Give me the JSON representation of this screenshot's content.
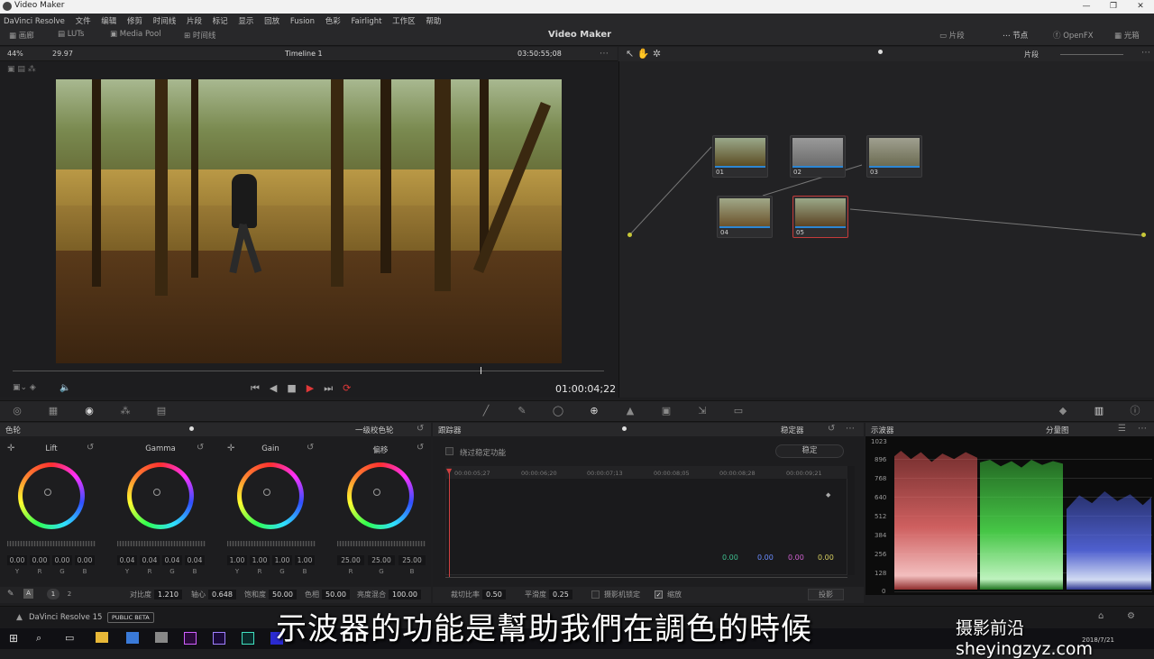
{
  "window": {
    "title": "Video Maker",
    "controls": [
      "—",
      "❐",
      "✕"
    ]
  },
  "menu": [
    "DaVinci Resolve",
    "文件",
    "编辑",
    "修剪",
    "时间线",
    "片段",
    "标记",
    "显示",
    "回放",
    "Fusion",
    "色彩",
    "Fairlight",
    "工作区",
    "帮助"
  ],
  "toolbar": {
    "gallery": "画廊",
    "luts": "LUTs",
    "media_pool": "Media Pool",
    "timeline": "时间线",
    "project_title": "Video Maker",
    "clips": "片段",
    "nodes": "节点",
    "openfx": "OpenFX",
    "lightbox": "光箱"
  },
  "viewer": {
    "zoom": "44%",
    "fps": "29.97",
    "timeline_name": "Timeline 1",
    "source_tc": "03:50:55;08",
    "record_tc": "01:00:04;22"
  },
  "node_editor": {
    "mode": "片段",
    "nodes": [
      {
        "id": "01",
        "label": "01"
      },
      {
        "id": "02",
        "label": "02"
      },
      {
        "id": "03",
        "label": "03"
      },
      {
        "id": "04",
        "label": "04"
      },
      {
        "id": "05",
        "label": "05"
      }
    ]
  },
  "color_wheels": {
    "title": "色轮",
    "mode": "一级校色轮",
    "wheels": [
      {
        "name": "Lift",
        "values": [
          "0.00",
          "0.00",
          "0.00",
          "0.00"
        ],
        "channels": [
          "Y",
          "R",
          "G",
          "B"
        ]
      },
      {
        "name": "Gamma",
        "values": [
          "0.04",
          "0.04",
          "0.04",
          "0.04"
        ],
        "channels": [
          "Y",
          "R",
          "G",
          "B"
        ]
      },
      {
        "name": "Gain",
        "values": [
          "1.00",
          "1.00",
          "1.00",
          "1.00"
        ],
        "channels": [
          "Y",
          "R",
          "G",
          "B"
        ]
      },
      {
        "name": "偏移",
        "values": [
          "25.00",
          "25.00",
          "25.00"
        ],
        "channels": [
          "R",
          "G",
          "B"
        ]
      }
    ],
    "footer": {
      "page1": "1",
      "page2": "2",
      "contrast_label": "对比度",
      "contrast": "1.210",
      "pivot_label": "轴心",
      "pivot": "0.648",
      "sat_label": "饱和度",
      "sat": "50.00",
      "hue_label": "色相",
      "hue": "50.00",
      "lummix_label": "亮度混合",
      "lummix": "100.00"
    }
  },
  "tracker": {
    "title": "跟踪器",
    "mode": "稳定器",
    "bypass_label": "绕过稳定功能",
    "stabilize_btn": "稳定",
    "ruler": [
      "00:00:05;27",
      "00:00:06;20",
      "00:00:07;13",
      "00:00:08;05",
      "00:00:08;28",
      "00:00:09;21"
    ],
    "readouts": [
      "0.00",
      "0.00",
      "0.00",
      "0.00"
    ],
    "readout_colors": [
      "#3fbf8f",
      "#6a8cff",
      "#d060d0",
      "#d8d060"
    ],
    "footer": {
      "crop_label": "裁切比率",
      "crop": "0.50",
      "smooth_label": "平滑度",
      "smooth": "0.25",
      "cam_lock_label": "摄影机锁定",
      "zoom_label": "缩放",
      "mode_btn": "投影"
    }
  },
  "scopes": {
    "title": "示波器",
    "mode": "分量图",
    "ticks": [
      "1023",
      "896",
      "768",
      "640",
      "512",
      "384",
      "256",
      "128",
      "0"
    ]
  },
  "status": {
    "app": "DaVinci Resolve 15",
    "badge": "PUBLIC BETA",
    "date": "2018/7/21"
  },
  "overlay": {
    "subtitle": "示波器的功能是幫助我們在調色的時候",
    "watermark": "摄影前沿 sheyingzyz.com"
  }
}
